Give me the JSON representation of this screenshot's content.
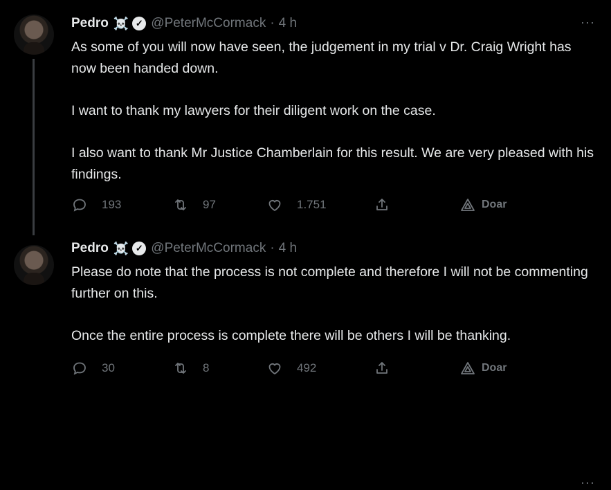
{
  "tweets": [
    {
      "author_name": "Pedro",
      "emoji": "☠️",
      "verified_mark": "✓",
      "handle": "@PeterMcCormack",
      "separator": "·",
      "time": "4 h",
      "more": "···",
      "paragraphs": [
        "As some of you will now have seen, the judgement in my trial v Dr. Craig Wright has now been handed down.",
        "I want to thank my lawyers for their diligent work on the case.",
        "I also want to thank Mr Justice Chamberlain for this result. We are very pleased with his findings."
      ],
      "replies": "193",
      "retweets": "97",
      "likes": "1.751",
      "donate_label": "Doar"
    },
    {
      "author_name": "Pedro",
      "emoji": "☠️",
      "verified_mark": "✓",
      "handle": "@PeterMcCormack",
      "separator": "·",
      "time": "4 h",
      "more": "···",
      "paragraphs": [
        "Please do note that the process is not complete and therefore I will not be commenting further on this.",
        "Once the entire process is complete there will be others I will be thanking."
      ],
      "replies": "30",
      "retweets": "8",
      "likes": "492",
      "donate_label": "Doar"
    }
  ],
  "icons": [
    "reply-icon",
    "retweet-icon",
    "like-icon",
    "share-icon",
    "donate-icon",
    "more-icon",
    "verified-badge-icon"
  ],
  "colors": {
    "background": "#000000",
    "text": "#e7e9ea",
    "muted": "#71767b"
  }
}
